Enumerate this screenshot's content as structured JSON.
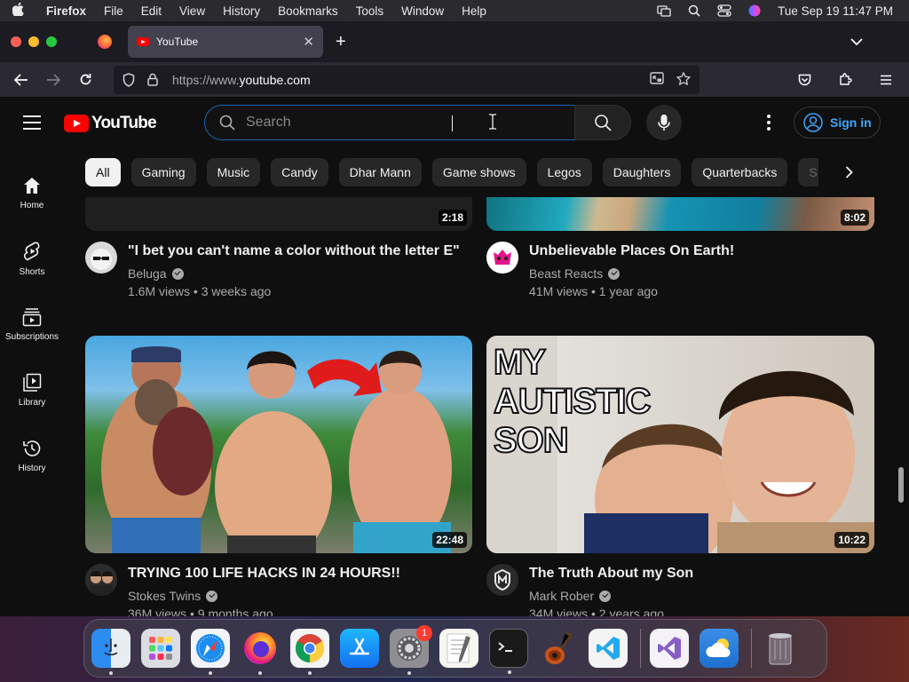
{
  "menubar": {
    "app": "Firefox",
    "items": [
      "File",
      "Edit",
      "View",
      "History",
      "Bookmarks",
      "Tools",
      "Window",
      "Help"
    ],
    "clock": "Tue Sep 19  11:47 PM"
  },
  "browser": {
    "tab_title": "YouTube",
    "url_proto": "https://www.",
    "url_host": "youtube.com"
  },
  "youtube": {
    "logo_text": "YouTube",
    "search_placeholder": "Search",
    "sign_in": "Sign in",
    "chips": [
      "All",
      "Gaming",
      "Music",
      "Candy",
      "Dhar Mann",
      "Game shows",
      "Legos",
      "Daughters",
      "Quarterbacks",
      "S"
    ],
    "sidebar": [
      {
        "label": "Home",
        "icon": "home-icon"
      },
      {
        "label": "Shorts",
        "icon": "shorts-icon"
      },
      {
        "label": "Subscriptions",
        "icon": "subscriptions-icon"
      },
      {
        "label": "Library",
        "icon": "library-icon"
      },
      {
        "label": "History",
        "icon": "history-icon"
      }
    ],
    "videos": [
      {
        "title": "\"I bet you can't name a color without the letter E\"",
        "channel": "Beluga",
        "meta": "1.6M views • 3 weeks ago",
        "duration": "2:18"
      },
      {
        "title": "Unbelievable Places On Earth!",
        "channel": "Beast Reacts",
        "meta": "41M views • 1 year ago",
        "duration": "8:02"
      },
      {
        "title": "TRYING 100 LIFE HACKS IN 24 HOURS!!",
        "channel": "Stokes Twins",
        "meta": "36M views • 9 months ago",
        "duration": "22:48"
      },
      {
        "title": "The Truth About my Son",
        "channel": "Mark Rober",
        "meta": "34M views • 2 years ago",
        "duration": "10:22"
      }
    ],
    "thumb_text": [
      "MY",
      "AUTISTIC",
      "SON"
    ]
  },
  "dock": {
    "apps": [
      "finder-icon",
      "launchpad-icon",
      "safari-icon",
      "firefox-icon",
      "chrome-icon",
      "app-store-icon",
      "system-settings-icon",
      "textedit-icon",
      "terminal-icon",
      "garageband-icon",
      "vscode-icon",
      "visual-studio-icon",
      "weather-icon",
      "trash-icon"
    ],
    "settings_badge": "1"
  },
  "colors": {
    "accent": "#3ea6ff",
    "brand": "#ff0000",
    "search_focus": "#1c62b9"
  }
}
